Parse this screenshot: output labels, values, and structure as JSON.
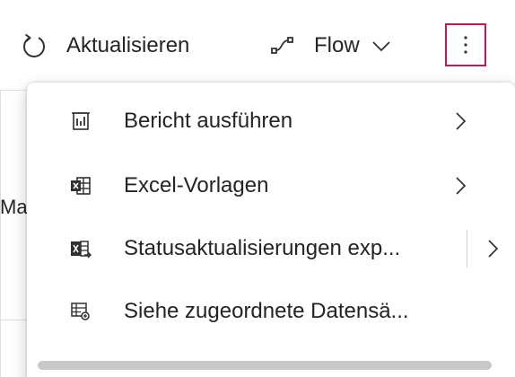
{
  "toolbar": {
    "refresh_label": "Aktualisieren",
    "flow_label": "Flow",
    "more_icon": "more-vertical-icon"
  },
  "background": {
    "partial_text": "Ma"
  },
  "menu": {
    "items": [
      {
        "label": "Bericht ausführen",
        "icon": "report-icon",
        "has_submenu": true,
        "split": false
      },
      {
        "label": "Excel-Vorlagen",
        "icon": "excel-template-icon",
        "has_submenu": true,
        "split": false
      },
      {
        "label": "Statusaktualisierungen exp...",
        "icon": "excel-export-icon",
        "has_submenu": true,
        "split": true
      },
      {
        "label": "Siehe zugeordnete Datensä...",
        "icon": "related-records-icon",
        "has_submenu": false,
        "split": false
      }
    ]
  },
  "colors": {
    "focus_border": "#c2185b",
    "text": "#242424",
    "icon": "#323130"
  }
}
